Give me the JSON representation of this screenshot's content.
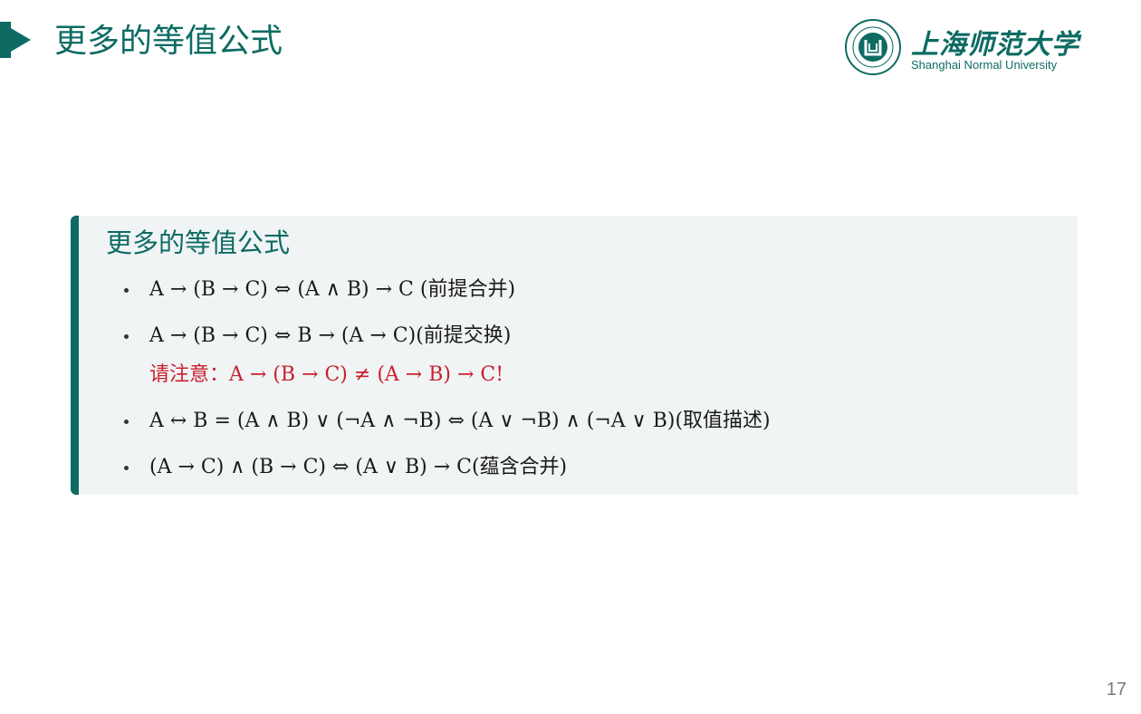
{
  "header": {
    "title": "更多的等值公式"
  },
  "logo": {
    "name_cn": "上海师范大学",
    "name_en": "Shanghai Normal University",
    "seal_text": "SHANGHAI NORMAL UNIVERSITY"
  },
  "block": {
    "title": "更多的等值公式",
    "items": [
      {
        "text": "A → (B → C) ⇔ (A ∧ B) → C (前提合并)"
      },
      {
        "text": "A → (B → C) ⇔ B → (A → C)(前提交换)"
      },
      {
        "note": "请注意：A → (B → C) ≠ (A → B) → C!"
      },
      {
        "text": "A ↔ B = (A ∧ B) ∨ (¬A ∧ ¬B) ⇔ (A ∨ ¬B) ∧ (¬A ∨ B)(取值描述)"
      },
      {
        "text": "(A → C) ∧ (B → C) ⇔ (A ∨ B) → C(蕴含合并)"
      }
    ]
  },
  "footer": {
    "page_number": "17"
  },
  "colors": {
    "accent": "#0d6b63",
    "note": "#c8202e",
    "block_bg": "#f1f4f5"
  }
}
